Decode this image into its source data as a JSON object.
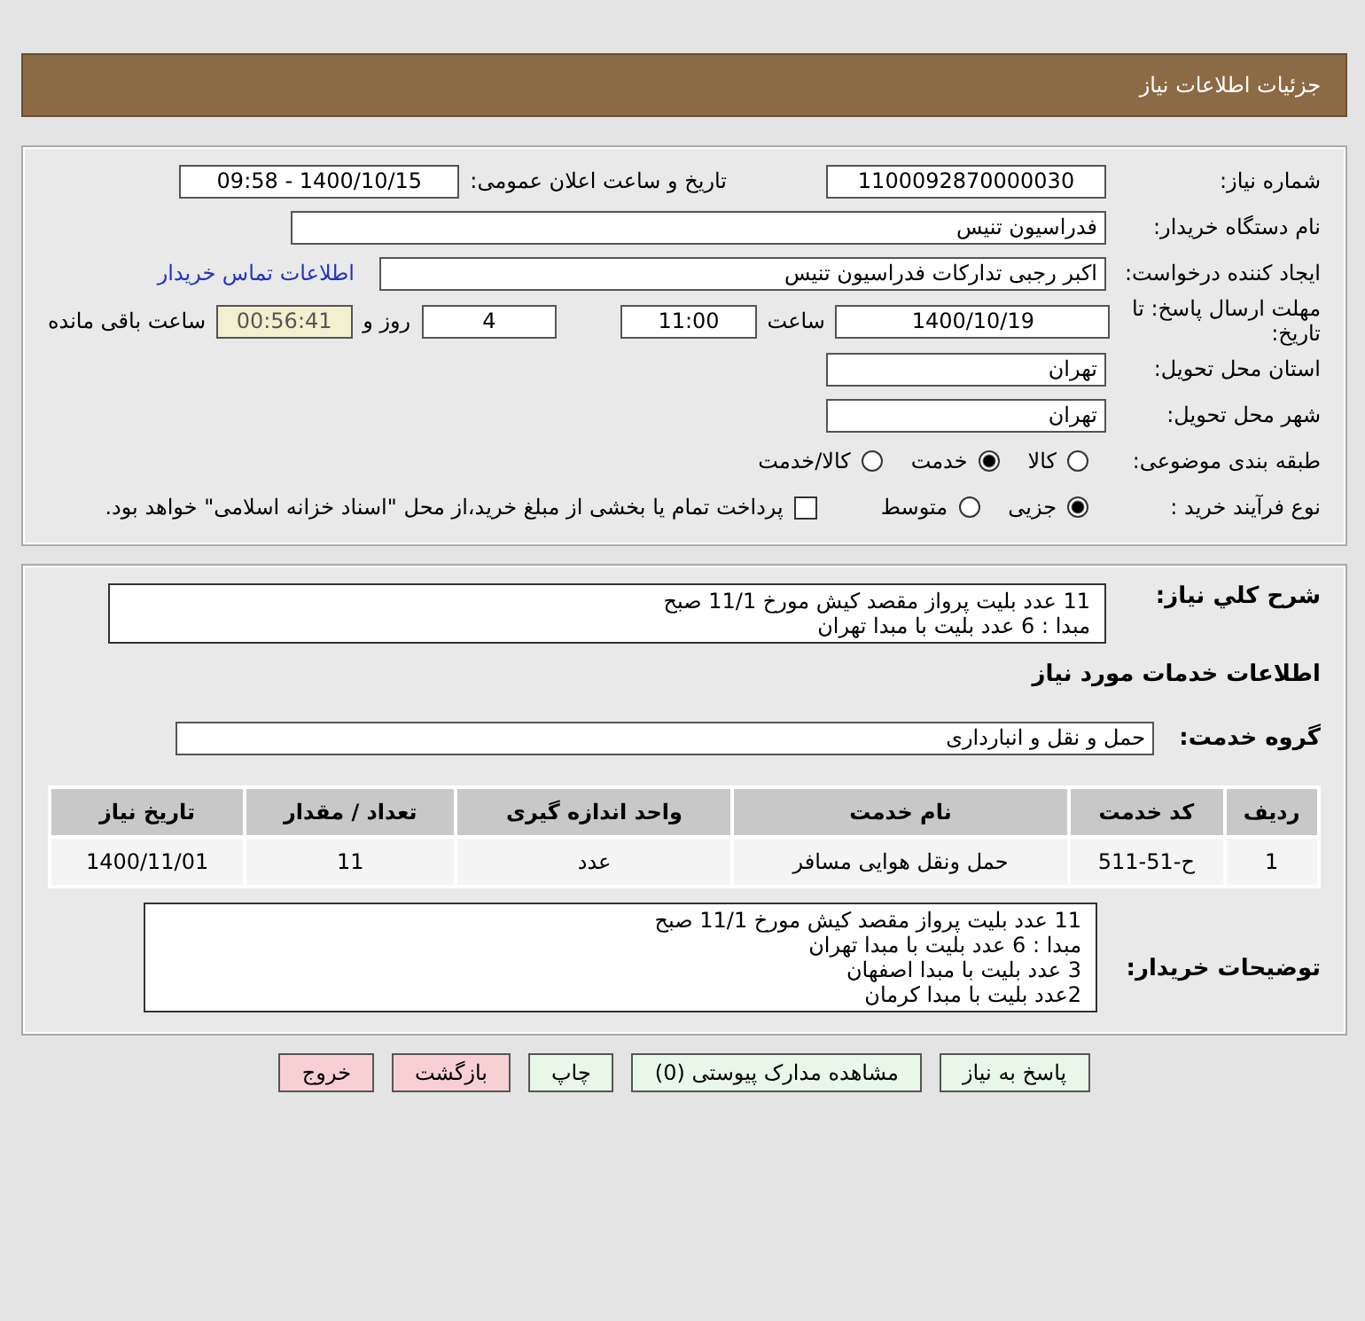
{
  "header": {
    "title": "جزئیات اطلاعات نیاز"
  },
  "need_number": {
    "label": "شماره نیاز:",
    "value": "1100092870000030"
  },
  "announce": {
    "label": "تاریخ و ساعت اعلان عمومی:",
    "value": "1400/10/15 - 09:58"
  },
  "buyer_org": {
    "label": "نام دستگاه خریدار:",
    "value": "فدراسیون تنیس"
  },
  "requester": {
    "label": "ایجاد کننده درخواست:",
    "value": "اکبر رجبی تدارکات فدراسیون تنیس",
    "link": "اطلاعات تماس خریدار"
  },
  "deadline": {
    "label": "مهلت ارسال پاسخ: تا تاریخ:",
    "date": "1400/10/19",
    "time_label": "ساعت",
    "time": "11:00",
    "days": "4",
    "days_label": "روز و",
    "remaining": "00:56:41",
    "remaining_label": "ساعت باقی مانده"
  },
  "province": {
    "label": "استان محل تحویل:",
    "value": "تهران"
  },
  "city": {
    "label": "شهر محل تحویل:",
    "value": "تهران"
  },
  "category": {
    "label": "طبقه بندی موضوعی:",
    "options": [
      {
        "label": "کالا",
        "selected": false
      },
      {
        "label": "خدمت",
        "selected": true
      },
      {
        "label": "کالا/خدمت",
        "selected": false
      }
    ]
  },
  "process": {
    "label": "نوع فرآیند خرید :",
    "options": [
      {
        "label": "جزیی",
        "selected": true
      },
      {
        "label": "متوسط",
        "selected": false
      }
    ],
    "payment": {
      "label": "پرداخت تمام یا بخشی از مبلغ خرید،از محل \"اسناد خزانه اسلامی\" خواهد بود.",
      "checked": false
    }
  },
  "summary": {
    "label": "شرح کلي نياز:",
    "lines": [
      "11 عدد بلیت پرواز مقصد کیش مورخ 11/1 صبح",
      "مبدا : 6 عدد بلیت با مبدا تهران"
    ]
  },
  "services_title": "اطلاعات خدمات مورد نیاز",
  "service_group": {
    "label": "گروه خدمت:",
    "value": "حمل و نقل و انبارداری"
  },
  "table": {
    "columns": [
      "ردیف",
      "کد خدمت",
      "نام خدمت",
      "واحد اندازه گیری",
      "تعداد / مقدار",
      "تاریخ نیاز"
    ],
    "rows": [
      [
        "1",
        "ح-51-511",
        "حمل ونقل هوایی مسافر",
        "عدد",
        "11",
        "1400/11/01"
      ]
    ]
  },
  "buyer_notes": {
    "label": "توضیحات خریدار:",
    "lines": [
      "11 عدد بلیت پرواز مقصد کیش مورخ 11/1 صبح",
      "مبدا : 6 عدد بلیت با مبدا تهران",
      "3  عدد بلیت با مبدا اصفهان",
      "2عدد بلیت با مبدا کرمان"
    ]
  },
  "buttons": [
    {
      "label": "پاسخ به نیاز",
      "kind": "normal"
    },
    {
      "label": "مشاهده مدارک پیوستی (0)",
      "kind": "normal"
    },
    {
      "label": "چاپ",
      "kind": "normal"
    },
    {
      "label": "بازگشت",
      "kind": "danger"
    },
    {
      "label": "خروج",
      "kind": "danger"
    }
  ]
}
